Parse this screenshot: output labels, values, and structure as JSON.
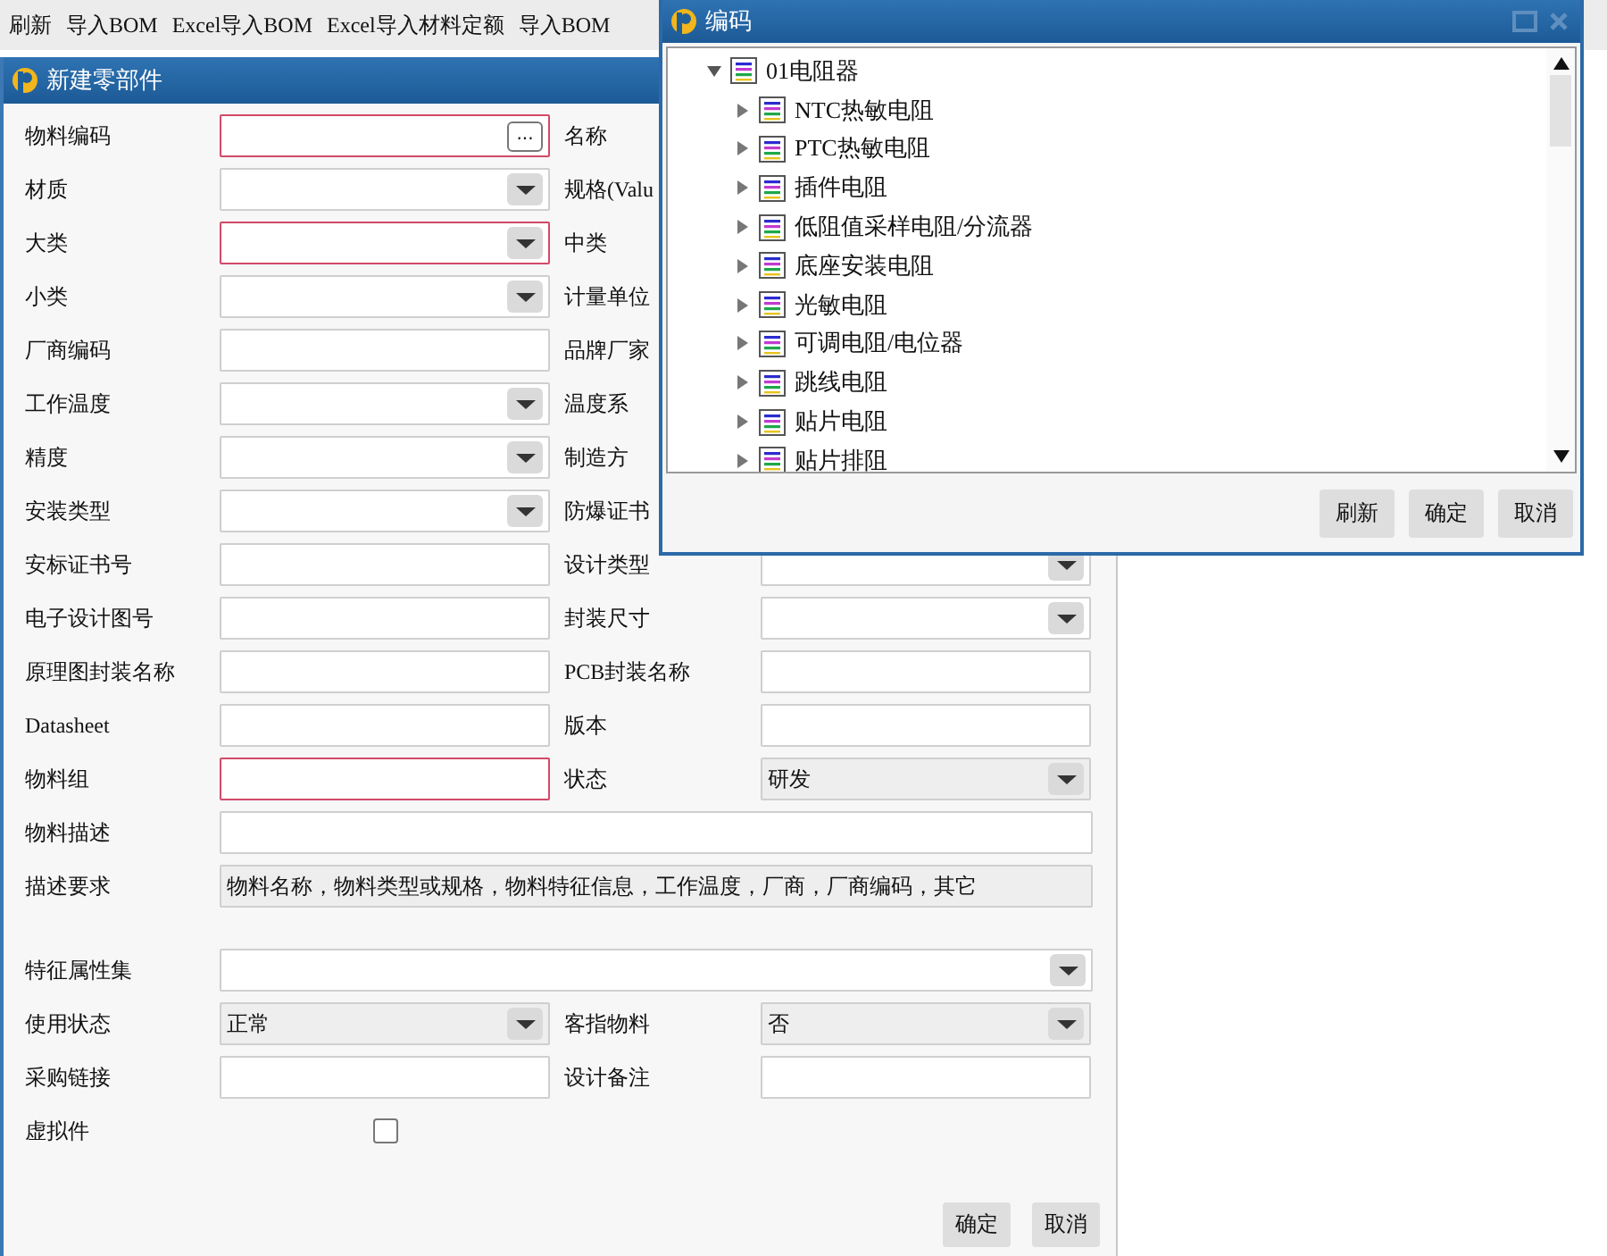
{
  "toolbar": [
    "刷新",
    "导入BOM",
    "Excel导入BOM",
    "Excel导入材料定额",
    "导入BOM"
  ],
  "form_dialog": {
    "title": "新建零部件",
    "rows": [
      {
        "kind": "pair",
        "items": [
          {
            "label": "物料编码",
            "field": {
              "kind": "lookup",
              "required": true,
              "button_label": "..."
            }
          },
          {
            "label": "名称"
          }
        ]
      },
      {
        "kind": "pair",
        "items": [
          {
            "label": "材质",
            "field": {
              "kind": "select",
              "required": false
            }
          },
          {
            "label": "规格(Valu"
          }
        ]
      },
      {
        "kind": "pair",
        "items": [
          {
            "label": "大类",
            "field": {
              "kind": "select",
              "required": true
            }
          },
          {
            "label": "中类"
          }
        ]
      },
      {
        "kind": "pair",
        "items": [
          {
            "label": "小类",
            "field": {
              "kind": "select",
              "required": false
            }
          },
          {
            "label": "计量单位"
          }
        ]
      },
      {
        "kind": "pair",
        "items": [
          {
            "label": "厂商编码",
            "field": {
              "kind": "text",
              "required": false
            }
          },
          {
            "label": "品牌厂家"
          }
        ]
      },
      {
        "kind": "pair",
        "items": [
          {
            "label": "工作温度",
            "field": {
              "kind": "select",
              "required": false
            }
          },
          {
            "label": "温度系"
          }
        ]
      },
      {
        "kind": "pair",
        "items": [
          {
            "label": "精度",
            "field": {
              "kind": "select",
              "required": false
            }
          },
          {
            "label": "制造方"
          }
        ]
      },
      {
        "kind": "pair",
        "items": [
          {
            "label": "安装类型",
            "field": {
              "kind": "select",
              "required": false
            }
          },
          {
            "label": "防爆证书"
          }
        ]
      },
      {
        "kind": "pair",
        "items": [
          {
            "label": "安标证书号",
            "field": {
              "kind": "text",
              "required": false
            }
          },
          {
            "label": "设计类型",
            "field": {
              "kind": "select",
              "required": false
            }
          }
        ]
      },
      {
        "kind": "pair",
        "items": [
          {
            "label": "电子设计图号",
            "field": {
              "kind": "text",
              "required": false
            }
          },
          {
            "label": "封装尺寸",
            "field": {
              "kind": "select",
              "required": false
            }
          }
        ]
      },
      {
        "kind": "pair",
        "items": [
          {
            "label": "原理图封装名称",
            "field": {
              "kind": "text",
              "required": false
            }
          },
          {
            "label": "PCB封装名称",
            "field": {
              "kind": "text",
              "required": false
            }
          }
        ]
      },
      {
        "kind": "pair",
        "items": [
          {
            "label": "Datasheet",
            "field": {
              "kind": "text",
              "required": false
            }
          },
          {
            "label": "版本",
            "field": {
              "kind": "text",
              "required": false
            }
          }
        ]
      },
      {
        "kind": "pair",
        "items": [
          {
            "label": "物料组",
            "field": {
              "kind": "text",
              "required": true
            }
          },
          {
            "label": "状态",
            "field": {
              "kind": "select",
              "required": false,
              "readonly": true,
              "value": "研发"
            }
          }
        ]
      },
      {
        "kind": "wide",
        "items": [
          {
            "label": "物料描述",
            "field": {
              "kind": "text",
              "required": false
            }
          }
        ]
      },
      {
        "kind": "wide",
        "items": [
          {
            "label": "描述要求",
            "field": {
              "kind": "text",
              "required": false,
              "readonly": true,
              "value": "物料名称，物料类型或规格，物料特征信息，工作温度，厂商，厂商编码，其它"
            }
          }
        ]
      },
      {
        "kind": "wide",
        "items": [
          {
            "label": "特征属性集",
            "field": {
              "kind": "select",
              "required": false
            }
          }
        ]
      },
      {
        "kind": "pair",
        "items": [
          {
            "label": "使用状态",
            "field": {
              "kind": "select",
              "required": false,
              "readonly": true,
              "value": "正常"
            }
          },
          {
            "label": "客指物料",
            "field": {
              "kind": "select",
              "required": false,
              "readonly": true,
              "value": "否"
            }
          }
        ]
      },
      {
        "kind": "pair",
        "items": [
          {
            "label": "采购链接",
            "field": {
              "kind": "text",
              "required": false
            }
          },
          {
            "label": "设计备注",
            "field": {
              "kind": "text",
              "required": false
            }
          }
        ]
      },
      {
        "kind": "check",
        "items": [
          {
            "label": "虚拟件",
            "field": {
              "kind": "checkbox",
              "checked": false
            }
          }
        ]
      }
    ],
    "buttons": [
      "确定",
      "取消"
    ]
  },
  "code_dialog": {
    "title": "编码",
    "tree": [
      {
        "label": "01电阻器",
        "expanded": true,
        "children": [
          {
            "label": "NTC热敏电阻",
            "expanded": false
          },
          {
            "label": "PTC热敏电阻",
            "expanded": false
          },
          {
            "label": "插件电阻",
            "expanded": false
          },
          {
            "label": "低阻值采样电阻/分流器",
            "expanded": false
          },
          {
            "label": "底座安装电阻",
            "expanded": false
          },
          {
            "label": "光敏电阻",
            "expanded": false
          },
          {
            "label": "可调电阻/电位器",
            "expanded": false
          },
          {
            "label": "跳线电阻",
            "expanded": false
          },
          {
            "label": "贴片电阻",
            "expanded": false
          },
          {
            "label": "贴片排阻",
            "expanded": false
          }
        ]
      }
    ],
    "buttons": [
      "刷新",
      "确定",
      "取消"
    ]
  }
}
